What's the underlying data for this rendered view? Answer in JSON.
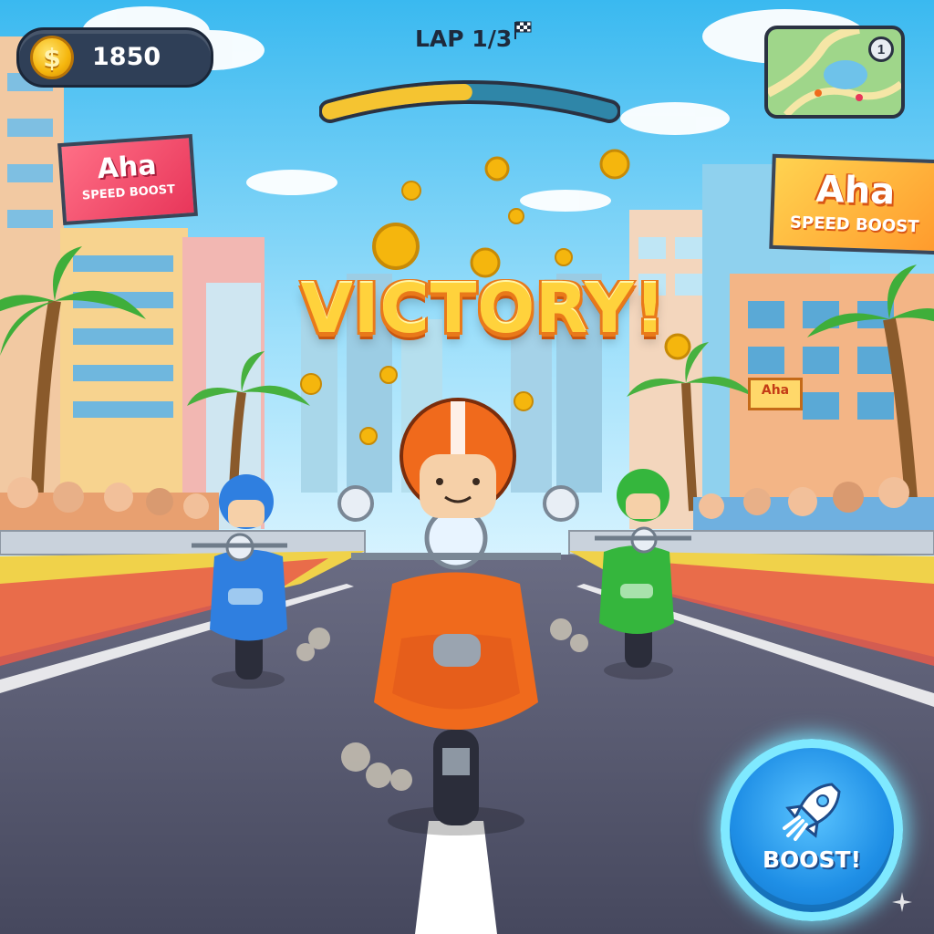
{
  "hud": {
    "coin_icon": "dollar-coin-icon",
    "coin_symbol": "$",
    "coin_count": "1850",
    "lap_text": "LAP 1/3",
    "lap_progress": 0.48,
    "minimap_badge": "1"
  },
  "banner": {
    "victory": "VICTORY!"
  },
  "billboards": {
    "left_title": "Aha",
    "left_sub": "SPEED BOOST",
    "right_title": "Aha",
    "right_sub": "SPEED BOOST",
    "small_title": "Aha"
  },
  "boost_button": {
    "icon": "rocket-icon",
    "label": "BOOST!"
  },
  "colors": {
    "sky": "#7fd3f5",
    "road": "#4d4f66",
    "player_scooter": "#f06a1c",
    "rival_left": "#2f7fe0",
    "rival_right": "#35b63d",
    "coin": "#f5b60d",
    "boost": "#1f8fe6"
  }
}
